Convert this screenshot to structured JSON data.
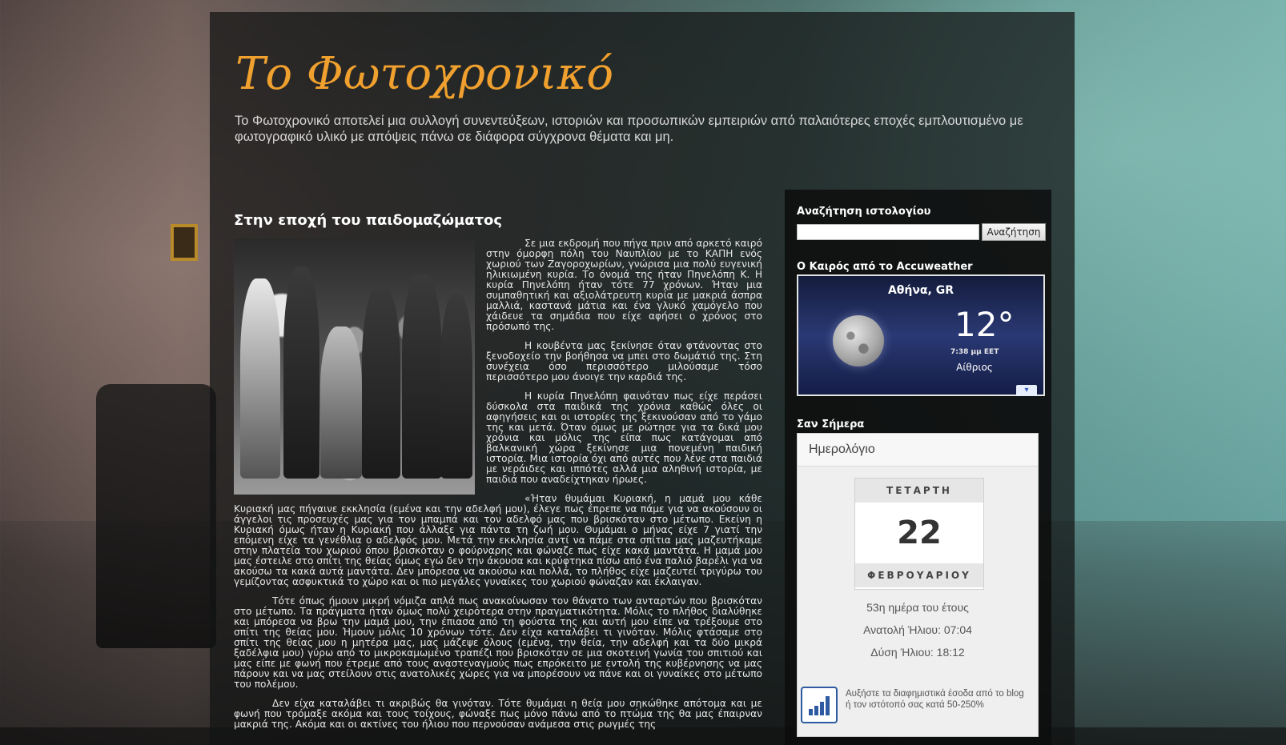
{
  "blog": {
    "title": "Το Φωτοχρονικό",
    "description": "Το Φωτοχρονικό αποτελεί μια συλλογή συνεντεύξεων, ιστοριών και προσωπικών εμπειριών από παλαιότερες εποχές εμπλουτισμένο με φωτογραφικό υλικό με απόψεις πάνω σε διάφορα σύγχρονα θέματα και μη."
  },
  "post": {
    "title": "Στην εποχή του παιδομαζώματος",
    "paragraphs": [
      "Σε μια εκδρομή που πήγα πριν από αρκετό καιρό στην όμορφη πόλη του Ναυπλίου με το ΚΑΠΗ ενός χωριού των Ζαγοροχωρίων, γνώρισα μια πολύ ευγενική ηλικιωμένη κυρία. Το όνομά της ήταν Πηνελόπη Κ. Η κυρία Πηνελόπη ήταν τότε 77 χρόνων. Ήταν μια συμπαθητική και αξιολάτρευτη κυρία με μακριά άσπρα μαλλιά, καστανά μάτια και ένα γλυκό χαμόγελο που χάιδευε τα σημάδια που είχε αφήσει ο χρόνος στο πρόσωπό της.",
      "Η κουβέντα μας ξεκίνησε όταν φτάνοντας στο ξενοδοχείο την βοήθησα να μπει στο δωμάτιό της. Στη συνέχεια όσο περισσότερο μιλούσαμε τόσο περισσότερο μου άνοιγε την καρδιά της.",
      "Η κυρία Πηνελόπη φαινόταν πως είχε περάσει δύσκολα στα παιδικά της χρόνια καθώς όλες οι αφηγήσεις και οι ιστορίες της ξεκινούσαν από το γάμο της και μετά. Όταν όμως με ρώτησε για τα δικά μου χρόνια και μόλις της είπα πως κατάγομαι από βαλκανική χώρα ξεκίνησε μια πονεμένη παιδική ιστορία. Μια ιστορία όχι από αυτές που λένε στα παιδιά με νεράιδες και ιππότες αλλά μια αληθινή ιστορία, με παιδιά που αναδείχτηκαν ήρωες.",
      "«Ήταν θυμάμαι Κυριακή, η μαμά μου κάθε Κυριακή μας πήγαινε εκκλησία (εμένα και την αδελφή μου), έλεγε πως έπρεπε να πάμε για να ακούσουν οι άγγελοι τις προσευχές μας για τον μπαμπά και τον αδελφό μας που βρισκόταν στο μέτωπο. Εκείνη η Κυριακή όμως ήταν η Κυριακή που άλλαξε για πάντα τη ζωή μου. Θυμάμαι ο μήνας είχε 7 γιατί την επόμενη είχε τα γενέθλια ο αδελφός μου. Μετά την εκκλησία αντί να πάμε στα σπίτια μας μαζευτήκαμε στην πλατεία του χωριού όπου βρισκόταν ο φούρναρης και φώναζε πως είχε κακά μαντάτα. Η μαμά μου μας έστειλε στο σπίτι της θείας όμως εγώ δεν την άκουσα και κρύφτηκα πίσω από ένα παλιό βαρέλι για να ακούσω τα κακά αυτά μαντάτα. Δεν μπόρεσα να ακούσω και πολλά, το πλήθος είχε μαζευτεί τριγύρω του γεμίζοντας ασφυκτικά το χώρο και οι πιο μεγάλες γυναίκες του χωριού φώναζαν και έκλαιγαν.",
      "Τότε όπως ήμουν μικρή νόμιζα απλά πως ανακοίνωσαν τον θάνατο των ανταρτών που βρισκόταν στο μέτωπο. Τα πράγματα ήταν όμως πολύ χειρότερα στην πραγματικότητα. Μόλις το πλήθος διαλύθηκε και μπόρεσα να βρω την μαμά μου, την έπιασα από τη φούστα της και αυτή μου είπε να τρέξουμε στο σπίτι της θείας μου. Ήμουν μόλις 10 χρόνων τότε. Δεν είχα καταλάβει τι γινόταν. Μόλις φτάσαμε στο σπίτι της θείας μου η μητέρα μας, μας μάζεψε όλους (εμένα, την θεία, την αδελφή και τα δύο μικρά ξαδέλφια μου) γύρω από το μικροκαμωμένο τραπέζι που βρισκόταν σε μια σκοτεινή γωνία του σπιτιού και μας είπε με φωνή που έτρεμε από τους αναστεναγμούς πως επρόκειτο με εντολή της κυβέρνησης να μας πάρουν και να μας στείλουν στις ανατολικές χώρες για να μπορέσουν να πάνε και οι γυναίκες στο μέτωπο του πολέμου.",
      "Δεν είχα καταλάβει τι ακριβώς θα γινόταν. Τότε θυμάμαι η θεία μου σηκώθηκε απότομα και με φωνή που τρόμαξε ακόμα και τους τοίχους, φώναξε πως μόνο πάνω από το πτώμα της θα μας έπαιρναν μακριά της. Ακόμα και οι ακτίνες του ήλιου που περνούσαν ανάμεσα στις ρωγμές της"
    ]
  },
  "sidebar": {
    "search": {
      "title": "Αναζήτηση ιστολογίου",
      "placeholder": "",
      "button_label": "Αναζήτηση"
    },
    "weather": {
      "title": "Ο Καιρός από το Accuweather",
      "city": "Αθήνα, GR",
      "temperature": "12°",
      "time": "7:38 μμ EET",
      "condition": "Αίθριος",
      "icon": "moon-icon"
    },
    "today": {
      "title": "Σαν Σήμερα",
      "header": "Ημερολόγιο",
      "weekday": "ΤΕΤΑΡΤΗ",
      "day": "22",
      "month": "ΦΕΒΡΟΥΑΡΙΟΥ",
      "day_of_year": "53η ημέρα του έτους",
      "sunrise": "Ανατολή Ήλιου: 07:04",
      "sunset": "Δύση Ήλιου: 18:12",
      "ad_text": "Αυξήστε τα διαφημιστικά έσοδα από το blog ή τον ιστότοπό σας κατά 50-250%"
    }
  },
  "colors": {
    "title": "#f0a02e",
    "accent_blue": "#2d5aa0"
  }
}
